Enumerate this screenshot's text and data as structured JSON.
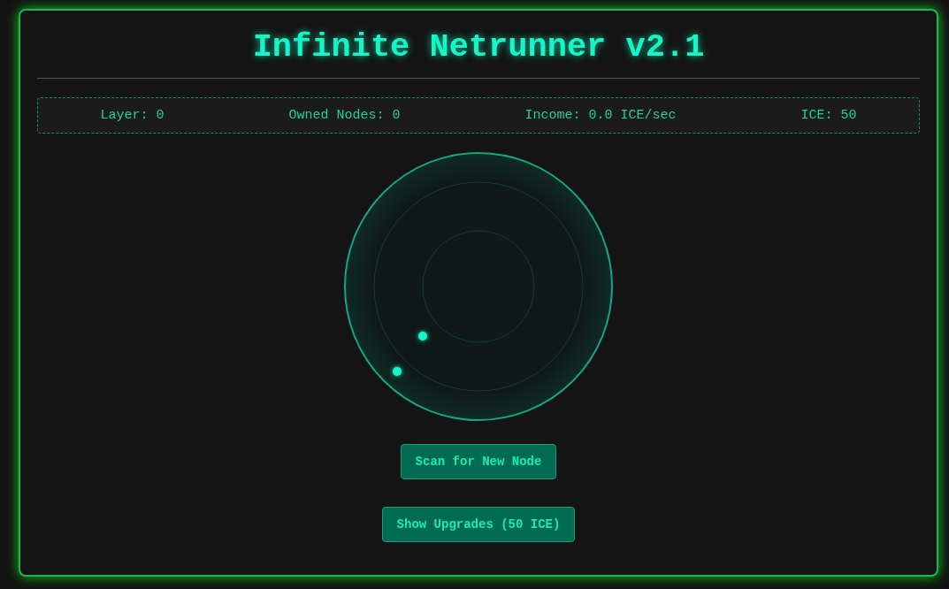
{
  "title": "Infinite Netrunner v2.1",
  "stats": [
    {
      "label": "Layer: 0"
    },
    {
      "label": "Owned Nodes: 0"
    },
    {
      "label": "Income: 0.0 ICE/sec"
    },
    {
      "label": "ICE: 50"
    }
  ],
  "buttons": [
    {
      "label": "Scan for New Node"
    },
    {
      "label": "Show Upgrades (50 ICE)"
    }
  ]
}
